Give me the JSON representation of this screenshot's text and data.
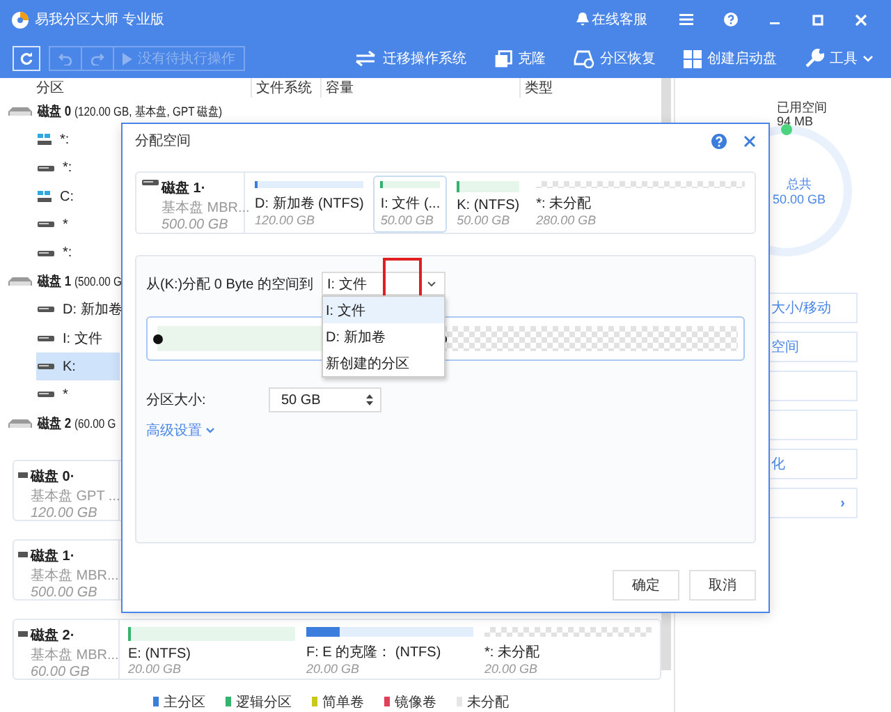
{
  "app": {
    "title": "易我分区大师 专业版",
    "support_label": "在线客服"
  },
  "toolbar": {
    "pending_label": "没有待执行操作",
    "pending_disabled": true,
    "actions": [
      {
        "label": "迁移操作系统",
        "kind": "migrate"
      },
      {
        "label": "克隆",
        "kind": "clone"
      },
      {
        "label": "分区恢复",
        "kind": "recover"
      },
      {
        "label": "创建启动盘",
        "kind": "bootdisk"
      },
      {
        "label": "工具",
        "kind": "tools"
      }
    ]
  },
  "table": {
    "columns": [
      "分区",
      "文件系统",
      "容量",
      "类型"
    ]
  },
  "tree": [
    {
      "label": "磁盘 0",
      "detail": "(120.00 GB, 基本盘, GPT 磁盘)",
      "children": [
        {
          "label": "*:",
          "kind": "system",
          "selected": false
        },
        {
          "label": "*:",
          "kind": "plain",
          "selected": false
        },
        {
          "label": "C:",
          "kind": "system",
          "selected": false
        },
        {
          "label": "*",
          "kind": "plain",
          "selected": false
        },
        {
          "label": "*:",
          "kind": "plain",
          "selected": false
        }
      ]
    },
    {
      "label": "磁盘 1",
      "detail": "(500.00 G",
      "children": [
        {
          "label": "D: 新加卷",
          "kind": "plain",
          "selected": false
        },
        {
          "label": "I: 文件",
          "kind": "plain",
          "selected": false
        },
        {
          "label": "K:",
          "kind": "plain",
          "selected": true
        },
        {
          "label": "*",
          "kind": "plain",
          "selected": false
        }
      ]
    },
    {
      "label": "磁盘 2",
      "detail": "(60.00 G"
    }
  ],
  "disk_cards": [
    {
      "name": "磁盘 0·",
      "type": "基本盘 GPT ...",
      "size": "120.00 GB"
    },
    {
      "name": "磁盘 1·",
      "type": "基本盘 MBR...",
      "size": "500.00 GB"
    },
    {
      "name": "磁盘 2·",
      "type": "基本盘 MBR...",
      "size": "60.00 GB",
      "partitions": [
        {
          "label": "E:  (NTFS)",
          "size": "20.00 GB",
          "kind": "logical",
          "level": 0.02
        },
        {
          "label": "F: E 的克隆：  (NTFS)",
          "size": "20.00 GB",
          "kind": "primary",
          "level": 0.2
        },
        {
          "label": "*: 未分配",
          "size": "20.00 GB",
          "kind": "unallocated"
        }
      ]
    }
  ],
  "legend": [
    {
      "label": "主分区",
      "color": "#3b7ddd"
    },
    {
      "label": "逻辑分区",
      "color": "#33b36b"
    },
    {
      "label": "简单卷",
      "color": "#c9c91a"
    },
    {
      "label": "镜像卷",
      "color": "#e0405a"
    },
    {
      "label": "未分配",
      "color": "#e6e6e6"
    }
  ],
  "side_panel": {
    "used_label": "已用空间",
    "used_value": "94 MB",
    "total_label": "总共",
    "total_value": "50.00 GB",
    "actions": [
      {
        "label": "大小/移动",
        "kind": "text"
      },
      {
        "label": "空间",
        "kind": "text"
      },
      {
        "kind": "blank"
      },
      {
        "kind": "blank"
      },
      {
        "label": "化",
        "kind": "text"
      },
      {
        "label": "›",
        "kind": "more"
      }
    ]
  },
  "dialog": {
    "title": "分配空间",
    "disk": {
      "name": "磁盘 1·",
      "type": "基本盘 MBR...",
      "size": "500.00 GB",
      "partitions": [
        {
          "label": "D: 新加卷 (NTFS)",
          "size": "120.00 GB",
          "kind": "primary",
          "level": 0.02,
          "selected": false
        },
        {
          "label": "I: 文件 (...",
          "size": "50.00 GB",
          "kind": "logical",
          "level": 0.02,
          "selected": true
        },
        {
          "label": "K:  (NTFS)",
          "size": "50.00 GB",
          "kind": "logical",
          "level": 0.02,
          "selected": false
        },
        {
          "label": "*: 未分配",
          "size": "280.00 GB",
          "kind": "unallocated",
          "selected": false
        }
      ]
    },
    "from_label": "从(K:)分配 0 Byte 的空间到",
    "target": {
      "value": "I: 文件",
      "expanded": true,
      "options": [
        {
          "label": "I: 文件",
          "selected": true
        },
        {
          "label": "D: 新加卷",
          "selected": false
        },
        {
          "label": "新创建的分区",
          "selected": false
        }
      ]
    },
    "slider": {
      "level": 0.49
    },
    "size_label": "分区大小:",
    "size_value": "50 GB",
    "advanced_label": "高级设置",
    "buttons": [
      "确定",
      "取消"
    ]
  }
}
